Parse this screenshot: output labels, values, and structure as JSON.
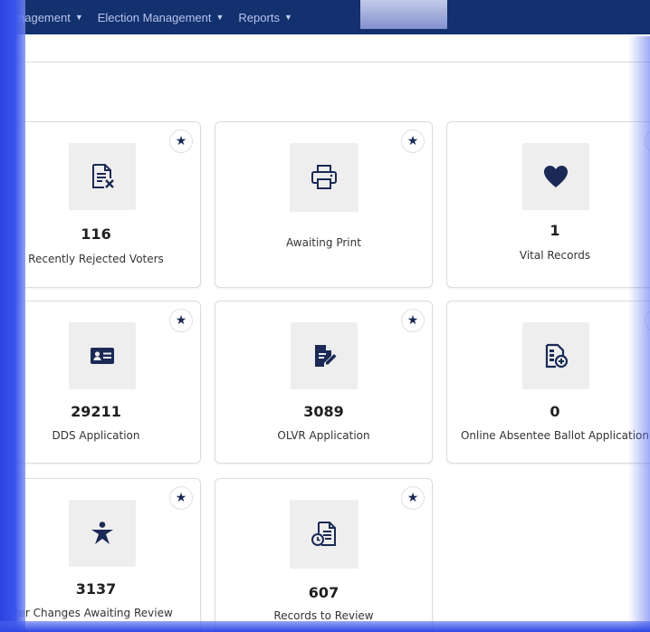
{
  "nav": {
    "items": [
      {
        "label": "nagement"
      },
      {
        "label": "Election Management"
      },
      {
        "label": "Reports"
      }
    ]
  },
  "cards": {
    "recently_rejected": {
      "count": "116",
      "label": "Recently Rejected Voters",
      "icon": "document-x-icon"
    },
    "awaiting_print": {
      "count": "",
      "label": "Awaiting Print",
      "icon": "printer-icon"
    },
    "vital_records": {
      "count": "1",
      "label": "Vital Records",
      "icon": "heart-icon"
    },
    "dds_application": {
      "count": "29211",
      "label": "DDS Application",
      "icon": "id-card-icon"
    },
    "olvr_application": {
      "count": "3089",
      "label": "OLVR Application",
      "icon": "document-edit-icon"
    },
    "online_absentee": {
      "count": "0",
      "label": "Online Absentee Ballot Application",
      "icon": "ballot-add-icon"
    },
    "voter_changes": {
      "count": "3137",
      "label": "Voter Changes Awaiting Review",
      "icon": "person-star-icon"
    },
    "records_to_review": {
      "count": "607",
      "label": "Records to Review",
      "icon": "document-clock-icon"
    }
  },
  "colors": {
    "nav_bg": "#13306f",
    "icon": "#1a2a55",
    "frame": "#2741d9"
  }
}
